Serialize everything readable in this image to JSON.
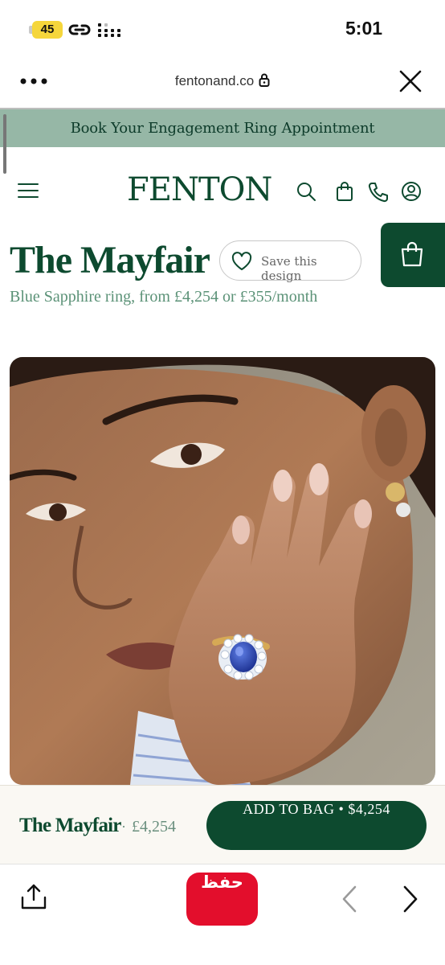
{
  "status_bar": {
    "battery": "45",
    "time": "5:01",
    "icons": [
      "link-icon",
      "signal-icon"
    ]
  },
  "browser": {
    "url": "fentonand.co",
    "icons": [
      "more-icon",
      "lock-icon",
      "close-icon"
    ]
  },
  "promo": {
    "text": "Book Your Engagement Ring Appointment"
  },
  "header": {
    "logo": "FENTON",
    "icons": [
      "hamburger-icon",
      "search-icon",
      "bag-icon",
      "phone-icon",
      "account-icon"
    ]
  },
  "product": {
    "title": "The Mayfair",
    "save_label": "Save this design",
    "subtitle": "Blue Sapphire ring, from £4,254 or £355/month"
  },
  "sticky_bar": {
    "name": "The Mayfair",
    "separator": "·",
    "price": "£4,254",
    "add_button": "ADD TO BAG • $4,254"
  },
  "toolbar": {
    "save_pill": "حفظ",
    "icons": [
      "share-icon",
      "back-icon",
      "forward-icon"
    ]
  },
  "colors": {
    "brand_green": "#0d4a2f",
    "promo_green": "#96b7a6",
    "subtitle_green": "#5b9277",
    "save_pill_red": "#e30e2c",
    "battery_yellow": "#f5d63b"
  }
}
